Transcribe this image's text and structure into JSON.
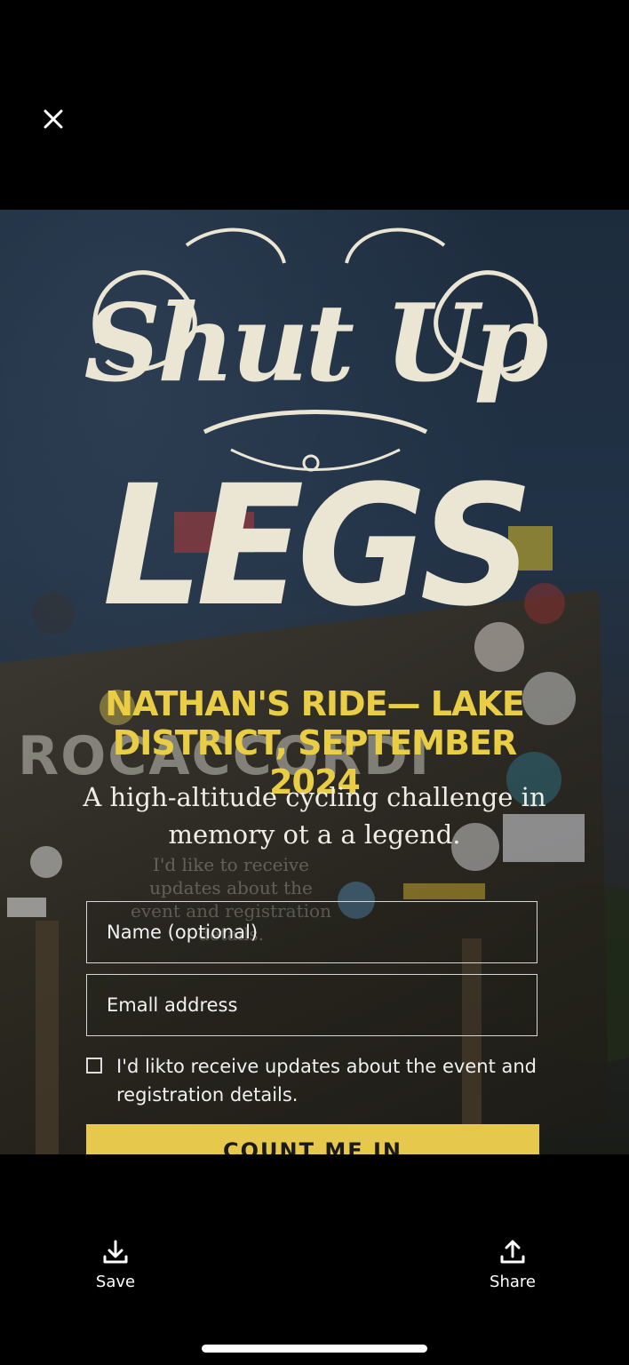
{
  "toolbar": {
    "close_icon": "close-icon"
  },
  "hero": {
    "logo_script": "Shut Up",
    "logo_block": "LEGS",
    "event_title": "NATHAN'S RIDE— LAKE DISTRICT, SEPTEMBER 2024",
    "tagline": "A high-altitude cycling challenge in memory ot a a legend.",
    "background_text": {
      "sign_word": "ROCACCORDI",
      "faded_consent": "I'd like to receive updates about the event and registration details."
    }
  },
  "form": {
    "name_placeholder": "Name (optional)",
    "email_placeholder": "Emall address",
    "consent_label": "I'd likto receive updates about the event and registration details.",
    "consent_checked": false,
    "submit_label": "COUNT ME IN"
  },
  "actions": {
    "save_label": "Save",
    "share_label": "Share"
  },
  "colors": {
    "accent_yellow": "#e8cd45",
    "logo_cream": "#ebe6d4",
    "background": "#000000"
  }
}
